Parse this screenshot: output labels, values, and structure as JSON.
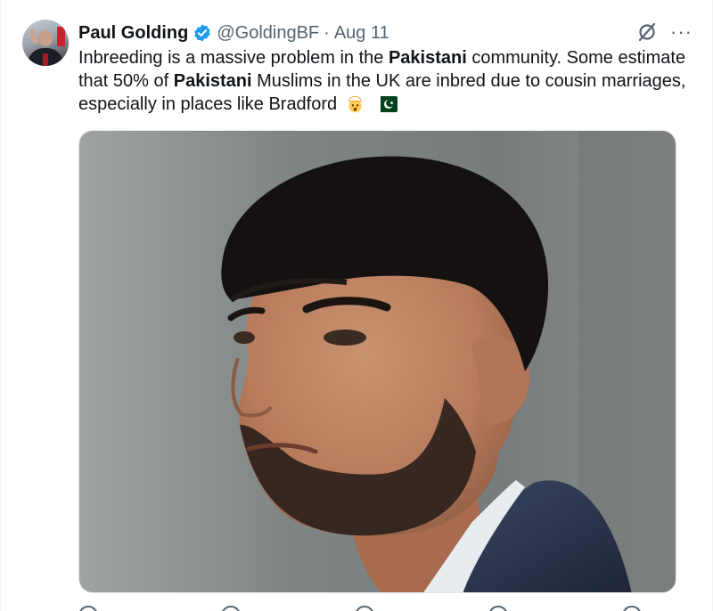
{
  "tweet": {
    "author": {
      "name": "Paul Golding",
      "handle": "@GoldingBF",
      "verified_color": "#1d9bf0"
    },
    "separator": "·",
    "date": "Aug 11",
    "text_parts": [
      "Inbreeding is a massive problem in the ",
      "Pakistani",
      " community. Some estimate that 50% of ",
      "Pakistani",
      " Muslims in the UK are inbred due to cousin marriages, especially in places like Bradford"
    ],
    "emojis": [
      "exploding-head",
      "pakistan-flag"
    ],
    "icons": {
      "grok": "grok-icon",
      "more": "···"
    },
    "actions": [
      "reply-icon",
      "retweet-icon",
      "like-icon",
      "views-icon",
      "bookmark-icon"
    ]
  }
}
